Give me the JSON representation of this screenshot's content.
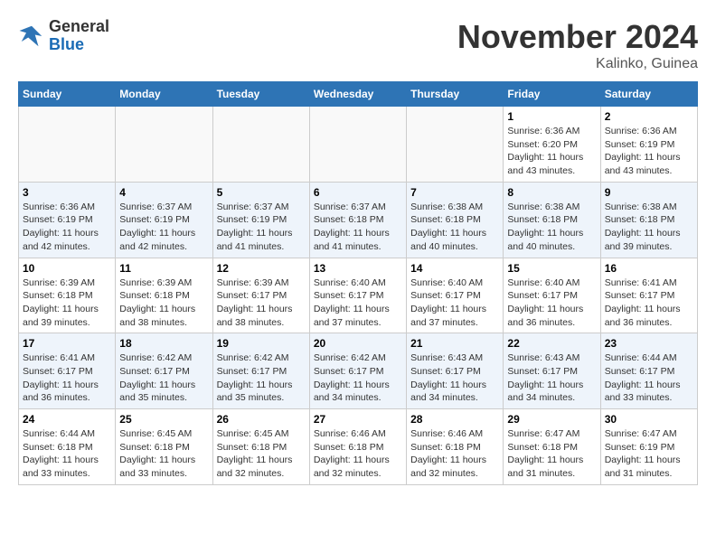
{
  "header": {
    "logo_general": "General",
    "logo_blue": "Blue",
    "month_title": "November 2024",
    "location": "Kalinko, Guinea"
  },
  "weekdays": [
    "Sunday",
    "Monday",
    "Tuesday",
    "Wednesday",
    "Thursday",
    "Friday",
    "Saturday"
  ],
  "weeks": [
    [
      {
        "day": "",
        "info": ""
      },
      {
        "day": "",
        "info": ""
      },
      {
        "day": "",
        "info": ""
      },
      {
        "day": "",
        "info": ""
      },
      {
        "day": "",
        "info": ""
      },
      {
        "day": "1",
        "info": "Sunrise: 6:36 AM\nSunset: 6:20 PM\nDaylight: 11 hours and 43 minutes."
      },
      {
        "day": "2",
        "info": "Sunrise: 6:36 AM\nSunset: 6:19 PM\nDaylight: 11 hours and 43 minutes."
      }
    ],
    [
      {
        "day": "3",
        "info": "Sunrise: 6:36 AM\nSunset: 6:19 PM\nDaylight: 11 hours and 42 minutes."
      },
      {
        "day": "4",
        "info": "Sunrise: 6:37 AM\nSunset: 6:19 PM\nDaylight: 11 hours and 42 minutes."
      },
      {
        "day": "5",
        "info": "Sunrise: 6:37 AM\nSunset: 6:19 PM\nDaylight: 11 hours and 41 minutes."
      },
      {
        "day": "6",
        "info": "Sunrise: 6:37 AM\nSunset: 6:18 PM\nDaylight: 11 hours and 41 minutes."
      },
      {
        "day": "7",
        "info": "Sunrise: 6:38 AM\nSunset: 6:18 PM\nDaylight: 11 hours and 40 minutes."
      },
      {
        "day": "8",
        "info": "Sunrise: 6:38 AM\nSunset: 6:18 PM\nDaylight: 11 hours and 40 minutes."
      },
      {
        "day": "9",
        "info": "Sunrise: 6:38 AM\nSunset: 6:18 PM\nDaylight: 11 hours and 39 minutes."
      }
    ],
    [
      {
        "day": "10",
        "info": "Sunrise: 6:39 AM\nSunset: 6:18 PM\nDaylight: 11 hours and 39 minutes."
      },
      {
        "day": "11",
        "info": "Sunrise: 6:39 AM\nSunset: 6:18 PM\nDaylight: 11 hours and 38 minutes."
      },
      {
        "day": "12",
        "info": "Sunrise: 6:39 AM\nSunset: 6:17 PM\nDaylight: 11 hours and 38 minutes."
      },
      {
        "day": "13",
        "info": "Sunrise: 6:40 AM\nSunset: 6:17 PM\nDaylight: 11 hours and 37 minutes."
      },
      {
        "day": "14",
        "info": "Sunrise: 6:40 AM\nSunset: 6:17 PM\nDaylight: 11 hours and 37 minutes."
      },
      {
        "day": "15",
        "info": "Sunrise: 6:40 AM\nSunset: 6:17 PM\nDaylight: 11 hours and 36 minutes."
      },
      {
        "day": "16",
        "info": "Sunrise: 6:41 AM\nSunset: 6:17 PM\nDaylight: 11 hours and 36 minutes."
      }
    ],
    [
      {
        "day": "17",
        "info": "Sunrise: 6:41 AM\nSunset: 6:17 PM\nDaylight: 11 hours and 36 minutes."
      },
      {
        "day": "18",
        "info": "Sunrise: 6:42 AM\nSunset: 6:17 PM\nDaylight: 11 hours and 35 minutes."
      },
      {
        "day": "19",
        "info": "Sunrise: 6:42 AM\nSunset: 6:17 PM\nDaylight: 11 hours and 35 minutes."
      },
      {
        "day": "20",
        "info": "Sunrise: 6:42 AM\nSunset: 6:17 PM\nDaylight: 11 hours and 34 minutes."
      },
      {
        "day": "21",
        "info": "Sunrise: 6:43 AM\nSunset: 6:17 PM\nDaylight: 11 hours and 34 minutes."
      },
      {
        "day": "22",
        "info": "Sunrise: 6:43 AM\nSunset: 6:17 PM\nDaylight: 11 hours and 34 minutes."
      },
      {
        "day": "23",
        "info": "Sunrise: 6:44 AM\nSunset: 6:17 PM\nDaylight: 11 hours and 33 minutes."
      }
    ],
    [
      {
        "day": "24",
        "info": "Sunrise: 6:44 AM\nSunset: 6:18 PM\nDaylight: 11 hours and 33 minutes."
      },
      {
        "day": "25",
        "info": "Sunrise: 6:45 AM\nSunset: 6:18 PM\nDaylight: 11 hours and 33 minutes."
      },
      {
        "day": "26",
        "info": "Sunrise: 6:45 AM\nSunset: 6:18 PM\nDaylight: 11 hours and 32 minutes."
      },
      {
        "day": "27",
        "info": "Sunrise: 6:46 AM\nSunset: 6:18 PM\nDaylight: 11 hours and 32 minutes."
      },
      {
        "day": "28",
        "info": "Sunrise: 6:46 AM\nSunset: 6:18 PM\nDaylight: 11 hours and 32 minutes."
      },
      {
        "day": "29",
        "info": "Sunrise: 6:47 AM\nSunset: 6:18 PM\nDaylight: 11 hours and 31 minutes."
      },
      {
        "day": "30",
        "info": "Sunrise: 6:47 AM\nSunset: 6:19 PM\nDaylight: 11 hours and 31 minutes."
      }
    ]
  ]
}
